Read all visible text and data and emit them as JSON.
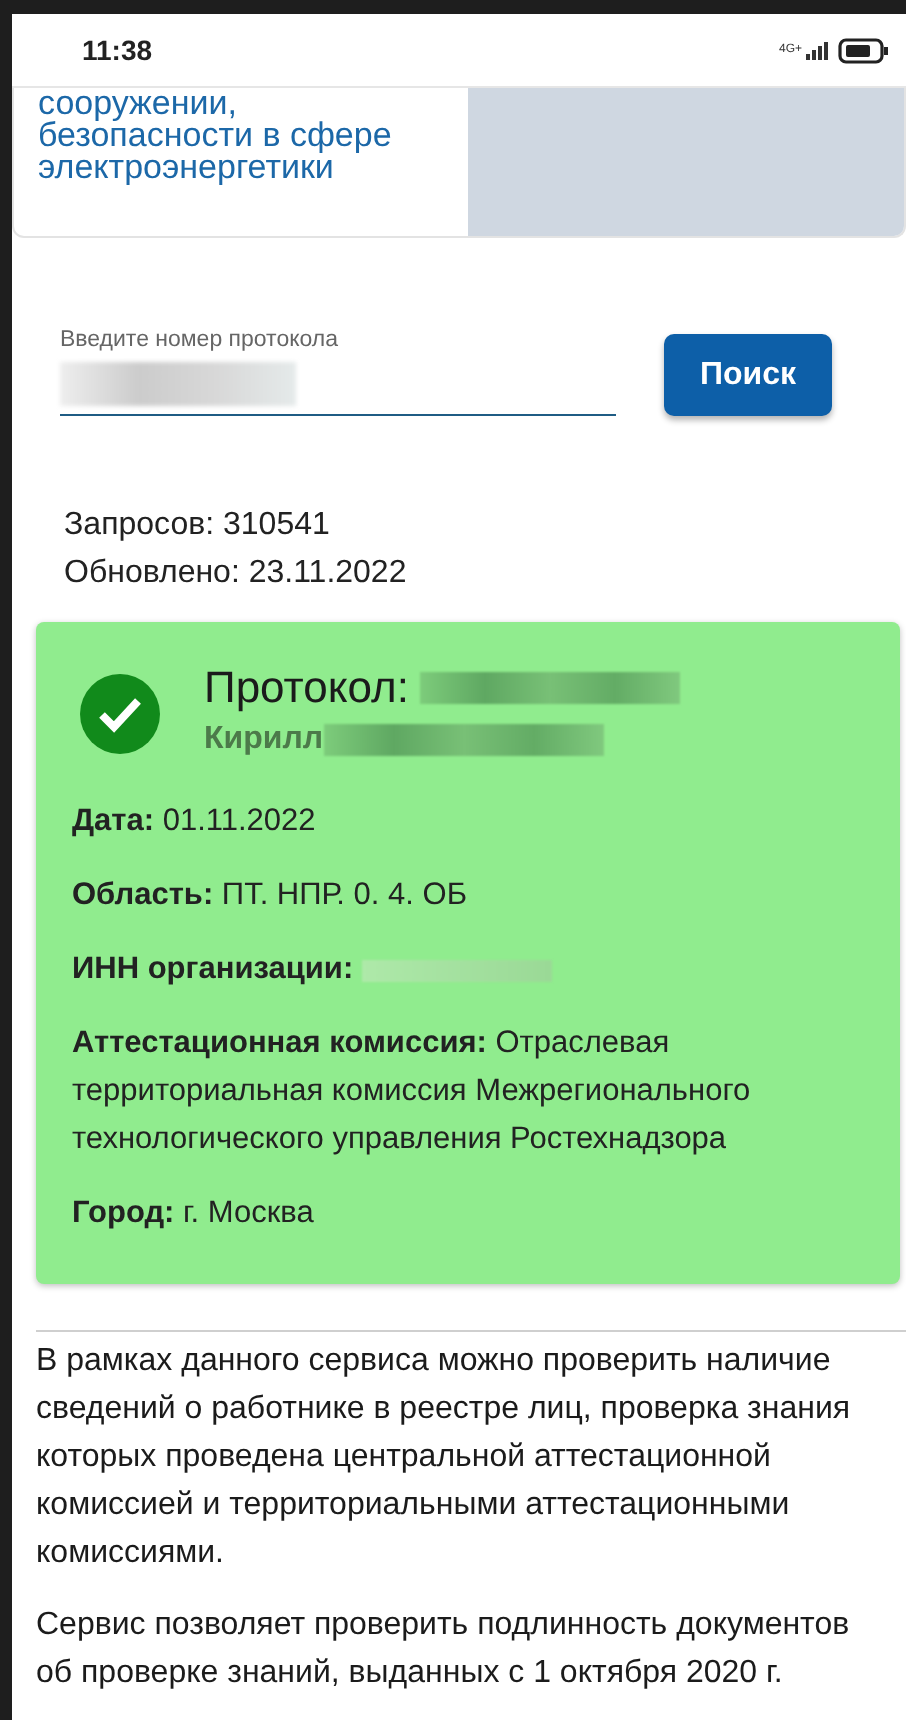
{
  "status_bar": {
    "time": "11:38",
    "network": "4G+"
  },
  "header_card": {
    "title_lines": [
      "сооружении,",
      "безопасности в сфере",
      "электроэнергетики"
    ]
  },
  "search": {
    "placeholder": "Введите номер протокола",
    "button": "Поиск"
  },
  "stats": [
    "Запросов: 310541",
    "Обновлено: 23.11.2022"
  ],
  "result": {
    "valid": true,
    "title": "Протокол:",
    "name": "Кирилл",
    "fields": [
      {
        "label": "Дата:",
        "value": "01.11.2022"
      },
      {
        "label": "Область:",
        "value": "ПТ. НПР. 0. 4. ОБ"
      },
      {
        "label": "ИНН организации:"
      },
      {
        "label": "Аттестационная комиссия:",
        "value": "Отраслевая территориальная комиссия Межрегионального технологического управления Ростехнадзора"
      },
      {
        "label": "Город:",
        "value": "г. Москва"
      }
    ]
  },
  "info": [
    "В рамках данного сервиса можно проверить наличие сведений о работнике в реестре лиц, проверка знания которых проведена центральной аттестационной комиссией и территориальными аттестационными комиссиями.",
    "Сервис позволяет проверить подлинность документов об проверке знаний, выданных с 1 октября 2020 г."
  ]
}
